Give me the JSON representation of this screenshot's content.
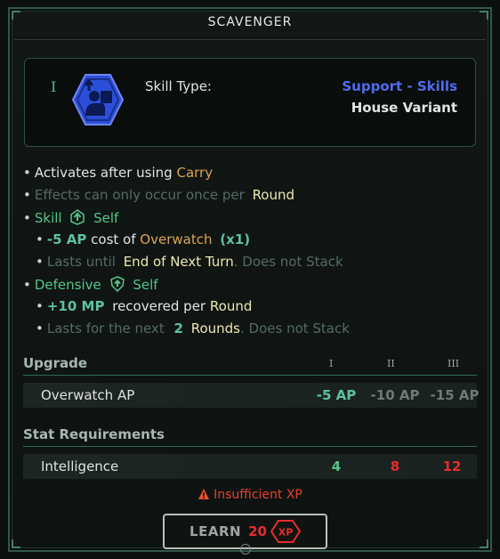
{
  "title": "SCAVENGER",
  "skill": {
    "tier": "I",
    "icon": "carry-support-icon",
    "type_label": "Skill Type:",
    "category": "Support - Skills",
    "variant": "House Variant"
  },
  "effects": {
    "e1": {
      "a": "Activates after using",
      "b": "Carry"
    },
    "e2": {
      "a": "Effects can only occur once per",
      "b": "Round"
    },
    "e3": {
      "a": "Skill",
      "b": "Self"
    },
    "e4": {
      "a": "-5 AP",
      "b": "cost of",
      "c": "Overwatch",
      "d": "(x1)"
    },
    "e5": {
      "a": "Lasts until",
      "b": "End of Next Turn",
      "c": "Does not Stack"
    },
    "e6": {
      "a": "Defensive",
      "b": "Self"
    },
    "e7": {
      "a": "+10 MP",
      "b": "recovered per",
      "c": "Round"
    },
    "e8": {
      "a": "Lasts for the next",
      "b": "2",
      "c": "Rounds",
      "d": "Does not Stack"
    }
  },
  "upgrade": {
    "header": "Upgrade",
    "tiers": [
      "I",
      "II",
      "III"
    ],
    "rows": [
      {
        "label": "Overwatch AP",
        "values": [
          "-5 AP",
          "-10 AP",
          "-15 AP"
        ]
      }
    ]
  },
  "requirements": {
    "header": "Stat Requirements",
    "rows": [
      {
        "label": "Intelligence",
        "values": [
          "4",
          "8",
          "12"
        ]
      }
    ]
  },
  "warning": "Insufficient XP",
  "learn": {
    "label": "LEARN",
    "cost": "20",
    "unit": "XP"
  },
  "colors": {
    "accent_green": "#55c58a",
    "category_blue": "#4f6cf0",
    "keyword_orange": "#d9a355",
    "error_red": "#e82c2c",
    "frame": "#2f5a45"
  }
}
